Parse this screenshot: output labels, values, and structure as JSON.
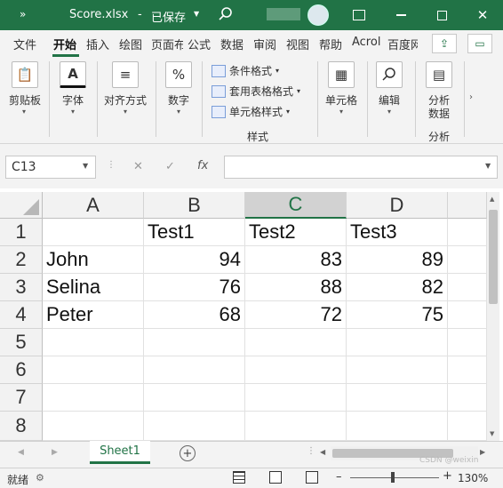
{
  "titlebar": {
    "autosave_icon": "list-arrows-icon",
    "filename": "Score.xlsx",
    "separator": "-",
    "save_status": "已保存",
    "dropdown_icon": "chevron-down-icon",
    "search_icon": "search-icon",
    "account_icon": "avatar-icon",
    "ribbon_display_icon": "ribbon-display-icon",
    "minimize_icon": "minimize-icon",
    "maximize_icon": "maximize-icon",
    "close_icon": "close-icon"
  },
  "tabs": [
    "文件",
    "开始",
    "插入",
    "绘图",
    "页面布",
    "公式",
    "数据",
    "审阅",
    "视图",
    "帮助",
    "Acrol",
    "百度网"
  ],
  "active_tab": "开始",
  "tab_right_icons": [
    "share-icon",
    "comment-icon"
  ],
  "ribbon": {
    "clipboard": {
      "label": "剪贴板",
      "icon": "clipboard-icon"
    },
    "font": {
      "label": "字体",
      "icon": "font-color-icon"
    },
    "alignment": {
      "label": "对齐方式",
      "icon": "align-icon"
    },
    "number": {
      "label": "数字",
      "icon": "percent-icon",
      "glyph": "%"
    },
    "styles": {
      "items": [
        "条件格式",
        "套用表格格式",
        "单元格样式"
      ],
      "group_label": "样式"
    },
    "cells": {
      "label": "单元格",
      "icon": "cells-icon"
    },
    "editing": {
      "label": "编辑",
      "icon": "search-icon"
    },
    "analysis": {
      "label_line1": "分析",
      "label_line2": "数据",
      "group_label": "分析",
      "icon": "analyze-data-icon"
    }
  },
  "formula_bar": {
    "name_box": "C13",
    "cancel_glyph": "✕",
    "enter_glyph": "✓",
    "fx_glyph": "fx",
    "formula_value": ""
  },
  "sheet": {
    "columns": [
      "A",
      "B",
      "C",
      "D"
    ],
    "selected_column": "C",
    "rows": [
      {
        "num": "1",
        "cells": [
          "",
          "Test1",
          "Test2",
          "Test3"
        ]
      },
      {
        "num": "2",
        "cells": [
          "John",
          "94",
          "83",
          "89"
        ]
      },
      {
        "num": "3",
        "cells": [
          "Selina",
          "76",
          "88",
          "82"
        ]
      },
      {
        "num": "4",
        "cells": [
          "Peter",
          "68",
          "72",
          "75"
        ]
      },
      {
        "num": "5",
        "cells": [
          "",
          "",
          "",
          ""
        ]
      },
      {
        "num": "6",
        "cells": [
          "",
          "",
          "",
          ""
        ]
      },
      {
        "num": "7",
        "cells": [
          "",
          "",
          "",
          ""
        ]
      },
      {
        "num": "8",
        "cells": [
          "",
          "",
          "",
          ""
        ]
      }
    ]
  },
  "sheet_tabs": {
    "active": "Sheet1",
    "add_glyph": "+"
  },
  "status": {
    "ready": "就绪",
    "zoom": "130%",
    "watermark": "CSDN @weixin"
  },
  "colors": {
    "accent": "#217346",
    "selected_header": "#d2d2d2"
  }
}
